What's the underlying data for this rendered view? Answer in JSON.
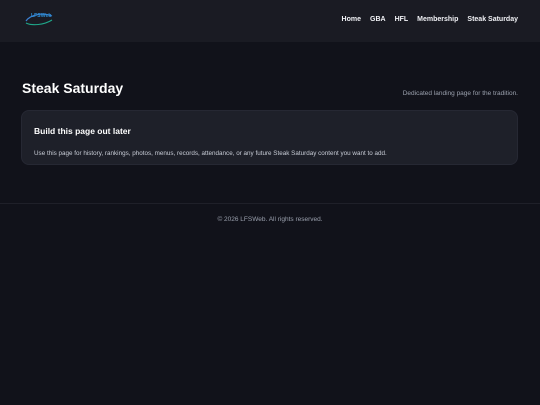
{
  "header": {
    "logo_text": "LFSWeb",
    "nav": [
      "Home",
      "GBA",
      "HFL",
      "Membership",
      "Steak Saturday"
    ]
  },
  "main": {
    "title": "Steak Saturday",
    "subtitle": "Dedicated landing page for the tradition.",
    "card": {
      "title": "Build this page out later",
      "body": "Use this page for history, rankings, photos, menus, records, attendance, or any future Steak Saturday content you want to add."
    }
  },
  "footer": {
    "copyright": "© 2026 LFSWeb. All rights reserved."
  },
  "colors": {
    "background": "#11121a",
    "header": "#1a1b23",
    "card": "#1e2029",
    "logo_accent": "#2c8fd6"
  }
}
